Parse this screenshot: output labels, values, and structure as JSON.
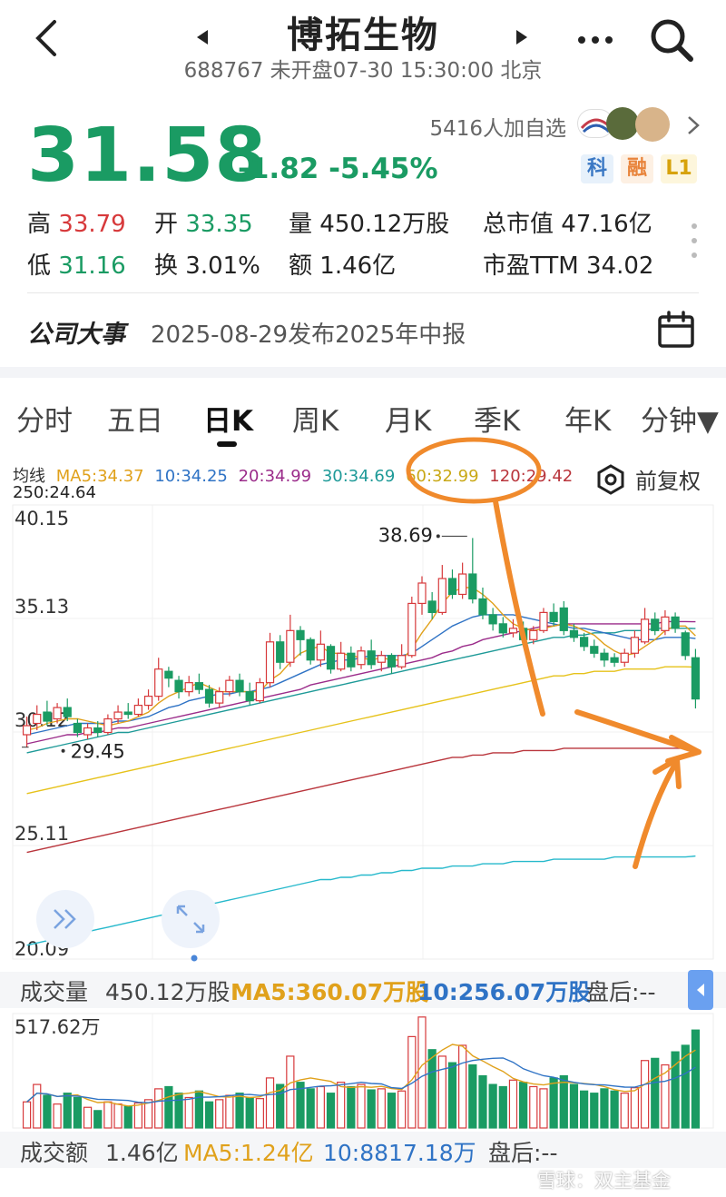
{
  "header": {
    "back_icon": "chevron-left-icon",
    "prev_icon": "triangle-left-icon",
    "next_icon": "triangle-right-icon",
    "title": "博拓生物",
    "subtitle": "688767 未开盘07-30 15:30:00 北京",
    "more_icon": "more-dots-icon",
    "search_icon": "search-icon"
  },
  "quote": {
    "price": "31.58",
    "change": "-1.82 -5.45%",
    "watchers": "5416人加自选",
    "tags": [
      "科",
      "融",
      "L1"
    ],
    "high_label": "高",
    "high": "33.79",
    "open_label": "开",
    "open": "33.35",
    "vol_label": "量",
    "vol": "450.12万股",
    "mcap_label": "总市值",
    "mcap": "47.16亿",
    "low_label": "低",
    "low": "31.16",
    "turn_label": "换",
    "turn": "3.01%",
    "amt_label": "额",
    "amt": "1.46亿",
    "pe_label": "市盈TTM",
    "pe": "34.02"
  },
  "event": {
    "title": "公司大事",
    "desc": "2025-08-29发布2025年中报",
    "calendar_icon": "calendar-icon"
  },
  "tabs": [
    "分时",
    "五日",
    "日K",
    "周K",
    "月K",
    "季K",
    "年K",
    "分钟▼"
  ],
  "active_tab": "日K",
  "ma_legend": {
    "label": "均线",
    "ma5": "MA5:34.37",
    "ma10": "10:34.25",
    "ma20": "20:34.99",
    "ma30": "30:34.69",
    "ma60": "60:32.99",
    "ma120": "120:29.42",
    "ma250": "250:24.64",
    "adjust": "前复权",
    "adjust_icon": "hexagon-settings-icon"
  },
  "colors": {
    "up": "#d7393b",
    "down": "#1a9b63",
    "ma5": "#e0a11b",
    "ma10": "#2f73c5",
    "ma20": "#9b2c8a",
    "ma30": "#1e9a98",
    "ma60": "#e6c21a",
    "ma120": "#b9353c",
    "ma250": "#27b9cc",
    "annotation": "#f08a2c"
  },
  "chart_data": {
    "type": "candlestick",
    "y_ticks": [
      "40.15",
      "35.13",
      "30.12",
      "25.11",
      "20.09"
    ],
    "ylim": [
      20.09,
      40.15
    ],
    "high_marker": "38.69",
    "low_marker": "29.45",
    "candles": [
      {
        "o": 30.0,
        "c": 30.4,
        "h": 30.8,
        "l": 29.45
      },
      {
        "o": 30.5,
        "c": 30.9,
        "h": 31.3,
        "l": 30.2
      },
      {
        "o": 31.0,
        "c": 30.6,
        "h": 31.5,
        "l": 30.4
      },
      {
        "o": 30.7,
        "c": 31.2,
        "h": 31.4,
        "l": 30.5
      },
      {
        "o": 31.2,
        "c": 30.8,
        "h": 31.6,
        "l": 30.6
      },
      {
        "o": 30.5,
        "c": 30.1,
        "h": 30.7,
        "l": 29.9
      },
      {
        "o": 30.0,
        "c": 30.3,
        "h": 30.5,
        "l": 29.8
      },
      {
        "o": 30.3,
        "c": 30.1,
        "h": 30.6,
        "l": 29.9
      },
      {
        "o": 30.1,
        "c": 30.7,
        "h": 30.9,
        "l": 30.0
      },
      {
        "o": 30.7,
        "c": 31.0,
        "h": 31.3,
        "l": 30.5
      },
      {
        "o": 31.0,
        "c": 30.9,
        "h": 31.4,
        "l": 30.7
      },
      {
        "o": 30.9,
        "c": 31.3,
        "h": 31.6,
        "l": 30.8
      },
      {
        "o": 31.3,
        "c": 31.7,
        "h": 32.0,
        "l": 31.1
      },
      {
        "o": 31.7,
        "c": 32.9,
        "h": 33.4,
        "l": 31.5
      },
      {
        "o": 32.8,
        "c": 32.5,
        "h": 33.0,
        "l": 32.1
      },
      {
        "o": 32.4,
        "c": 31.9,
        "h": 32.6,
        "l": 31.6
      },
      {
        "o": 31.9,
        "c": 32.3,
        "h": 32.6,
        "l": 31.7
      },
      {
        "o": 32.3,
        "c": 32.0,
        "h": 32.7,
        "l": 31.8
      },
      {
        "o": 32.0,
        "c": 31.4,
        "h": 32.2,
        "l": 31.2
      },
      {
        "o": 31.4,
        "c": 31.9,
        "h": 32.1,
        "l": 31.2
      },
      {
        "o": 31.9,
        "c": 32.4,
        "h": 32.6,
        "l": 31.7
      },
      {
        "o": 32.4,
        "c": 31.9,
        "h": 32.7,
        "l": 31.7
      },
      {
        "o": 31.9,
        "c": 31.5,
        "h": 32.3,
        "l": 31.3
      },
      {
        "o": 31.5,
        "c": 32.3,
        "h": 32.5,
        "l": 31.4
      },
      {
        "o": 32.3,
        "c": 34.1,
        "h": 34.5,
        "l": 32.1
      },
      {
        "o": 34.1,
        "c": 33.2,
        "h": 34.4,
        "l": 32.9
      },
      {
        "o": 33.2,
        "c": 34.6,
        "h": 35.3,
        "l": 33.0
      },
      {
        "o": 34.6,
        "c": 34.2,
        "h": 34.8,
        "l": 33.5
      },
      {
        "o": 34.2,
        "c": 33.3,
        "h": 34.3,
        "l": 33.1
      },
      {
        "o": 33.3,
        "c": 34.0,
        "h": 34.6,
        "l": 33.0
      },
      {
        "o": 33.9,
        "c": 32.9,
        "h": 34.0,
        "l": 32.7
      },
      {
        "o": 32.9,
        "c": 33.6,
        "h": 34.1,
        "l": 32.8
      },
      {
        "o": 33.6,
        "c": 33.0,
        "h": 33.9,
        "l": 32.8
      },
      {
        "o": 33.1,
        "c": 33.7,
        "h": 33.9,
        "l": 32.9
      },
      {
        "o": 33.7,
        "c": 33.1,
        "h": 34.2,
        "l": 32.9
      },
      {
        "o": 33.2,
        "c": 33.5,
        "h": 33.7,
        "l": 32.8
      },
      {
        "o": 33.5,
        "c": 33.0,
        "h": 33.6,
        "l": 32.7
      },
      {
        "o": 33.0,
        "c": 33.5,
        "h": 34.0,
        "l": 32.9
      },
      {
        "o": 33.5,
        "c": 35.8,
        "h": 36.1,
        "l": 33.4
      },
      {
        "o": 35.8,
        "c": 36.7,
        "h": 37.0,
        "l": 35.3
      },
      {
        "o": 35.9,
        "c": 35.4,
        "h": 36.3,
        "l": 35.1
      },
      {
        "o": 35.4,
        "c": 36.9,
        "h": 37.5,
        "l": 35.3
      },
      {
        "o": 36.9,
        "c": 36.2,
        "h": 37.3,
        "l": 36.0
      },
      {
        "o": 36.2,
        "c": 37.1,
        "h": 37.6,
        "l": 36.0
      },
      {
        "o": 37.1,
        "c": 36.0,
        "h": 38.69,
        "l": 35.8
      },
      {
        "o": 36.0,
        "c": 35.3,
        "h": 36.5,
        "l": 35.1
      },
      {
        "o": 35.3,
        "c": 34.9,
        "h": 35.6,
        "l": 34.6
      },
      {
        "o": 34.9,
        "c": 34.5,
        "h": 35.2,
        "l": 34.3
      },
      {
        "o": 34.5,
        "c": 34.7,
        "h": 35.1,
        "l": 34.3
      },
      {
        "o": 34.7,
        "c": 34.2,
        "h": 35.0,
        "l": 34.0
      },
      {
        "o": 34.2,
        "c": 34.6,
        "h": 34.8,
        "l": 34.0
      },
      {
        "o": 34.6,
        "c": 35.4,
        "h": 35.6,
        "l": 34.5
      },
      {
        "o": 35.4,
        "c": 35.0,
        "h": 35.8,
        "l": 34.8
      },
      {
        "o": 35.6,
        "c": 34.6,
        "h": 35.9,
        "l": 34.4
      },
      {
        "o": 34.6,
        "c": 34.3,
        "h": 34.9,
        "l": 34.1
      },
      {
        "o": 34.3,
        "c": 33.9,
        "h": 34.5,
        "l": 33.7
      },
      {
        "o": 33.9,
        "c": 33.6,
        "h": 34.2,
        "l": 33.4
      },
      {
        "o": 33.6,
        "c": 33.3,
        "h": 33.8,
        "l": 33.0
      },
      {
        "o": 33.4,
        "c": 33.2,
        "h": 33.6,
        "l": 33.0
      },
      {
        "o": 33.2,
        "c": 33.6,
        "h": 33.8,
        "l": 33.0
      },
      {
        "o": 33.6,
        "c": 34.3,
        "h": 34.6,
        "l": 33.4
      },
      {
        "o": 34.1,
        "c": 35.1,
        "h": 35.6,
        "l": 34.0
      },
      {
        "o": 35.1,
        "c": 34.6,
        "h": 35.4,
        "l": 34.4
      },
      {
        "o": 34.6,
        "c": 35.2,
        "h": 35.5,
        "l": 34.4
      },
      {
        "o": 35.2,
        "c": 34.7,
        "h": 35.4,
        "l": 34.5
      },
      {
        "o": 34.5,
        "c": 33.5,
        "h": 34.6,
        "l": 33.3
      },
      {
        "o": 33.4,
        "c": 31.58,
        "h": 33.79,
        "l": 31.16
      }
    ],
    "ma5": [
      30.2,
      30.3,
      30.5,
      30.6,
      30.7,
      30.7,
      30.6,
      30.5,
      30.4,
      30.5,
      30.6,
      30.8,
      31.0,
      31.4,
      31.7,
      31.9,
      32.1,
      32.3,
      32.1,
      31.9,
      31.9,
      31.9,
      31.9,
      31.9,
      32.4,
      32.7,
      33.2,
      33.6,
      33.8,
      33.9,
      33.6,
      33.6,
      33.5,
      33.4,
      33.3,
      33.4,
      33.3,
      33.3,
      33.8,
      34.5,
      35.1,
      35.8,
      36.3,
      36.5,
      36.5,
      36.2,
      35.8,
      35.3,
      34.9,
      34.7,
      34.6,
      34.7,
      34.8,
      34.9,
      34.8,
      34.6,
      34.4,
      34.0,
      33.7,
      33.5,
      33.6,
      33.9,
      34.2,
      34.6,
      34.8,
      34.8,
      34.37
    ],
    "ma10": [
      30.0,
      30.1,
      30.2,
      30.3,
      30.4,
      30.5,
      30.5,
      30.5,
      30.5,
      30.6,
      30.6,
      30.7,
      30.8,
      31.0,
      31.2,
      31.3,
      31.5,
      31.6,
      31.7,
      31.8,
      31.8,
      31.9,
      31.9,
      32.0,
      32.1,
      32.3,
      32.5,
      32.7,
      32.9,
      33.1,
      33.2,
      33.3,
      33.3,
      33.4,
      33.5,
      33.5,
      33.5,
      33.5,
      33.6,
      33.9,
      34.2,
      34.5,
      34.8,
      35.0,
      35.2,
      35.3,
      35.3,
      35.3,
      35.3,
      35.2,
      35.1,
      35.0,
      34.9,
      34.8,
      34.7,
      34.7,
      34.6,
      34.5,
      34.4,
      34.3,
      34.2,
      34.2,
      34.2,
      34.3,
      34.3,
      34.3,
      34.25
    ],
    "ma20": [
      29.6,
      29.7,
      29.8,
      29.9,
      30.0,
      30.0,
      30.1,
      30.1,
      30.2,
      30.3,
      30.3,
      30.4,
      30.5,
      30.6,
      30.7,
      30.8,
      30.9,
      31.0,
      31.1,
      31.2,
      31.3,
      31.4,
      31.5,
      31.6,
      31.7,
      31.8,
      31.9,
      32.0,
      32.2,
      32.3,
      32.4,
      32.5,
      32.6,
      32.7,
      32.8,
      32.9,
      33.0,
      33.1,
      33.2,
      33.3,
      33.4,
      33.6,
      33.7,
      33.9,
      34.0,
      34.2,
      34.3,
      34.4,
      34.5,
      34.6,
      34.7,
      34.8,
      34.8,
      34.9,
      34.9,
      34.9,
      34.9,
      34.9,
      34.9,
      34.9,
      34.9,
      34.9,
      34.9,
      35.0,
      35.0,
      35.0,
      34.99
    ],
    "ma30": [
      29.2,
      29.3,
      29.4,
      29.5,
      29.6,
      29.7,
      29.8,
      29.9,
      30.0,
      30.1,
      30.1,
      30.2,
      30.3,
      30.4,
      30.5,
      30.6,
      30.7,
      30.8,
      30.9,
      31.0,
      31.1,
      31.2,
      31.3,
      31.4,
      31.5,
      31.6,
      31.7,
      31.8,
      31.9,
      32.0,
      32.1,
      32.2,
      32.3,
      32.4,
      32.5,
      32.6,
      32.7,
      32.8,
      32.9,
      33.0,
      33.1,
      33.2,
      33.3,
      33.4,
      33.5,
      33.6,
      33.7,
      33.8,
      33.9,
      34.0,
      34.1,
      34.2,
      34.3,
      34.3,
      34.4,
      34.4,
      34.5,
      34.5,
      34.5,
      34.6,
      34.6,
      34.6,
      34.7,
      34.7,
      34.7,
      34.7,
      34.69
    ],
    "ma60": [
      27.4,
      27.5,
      27.6,
      27.7,
      27.8,
      27.9,
      28.0,
      28.1,
      28.2,
      28.3,
      28.4,
      28.5,
      28.6,
      28.7,
      28.8,
      28.9,
      29.0,
      29.1,
      29.2,
      29.3,
      29.4,
      29.5,
      29.6,
      29.7,
      29.8,
      29.9,
      30.0,
      30.1,
      30.2,
      30.3,
      30.4,
      30.5,
      30.6,
      30.7,
      30.8,
      30.9,
      31.0,
      31.1,
      31.2,
      31.3,
      31.4,
      31.5,
      31.6,
      31.7,
      31.8,
      31.9,
      32.0,
      32.1,
      32.2,
      32.3,
      32.4,
      32.5,
      32.6,
      32.6,
      32.7,
      32.7,
      32.8,
      32.8,
      32.8,
      32.9,
      32.9,
      32.9,
      32.9,
      33.0,
      33.0,
      33.0,
      32.99
    ],
    "ma120": [
      24.8,
      24.9,
      25.0,
      25.1,
      25.2,
      25.3,
      25.4,
      25.5,
      25.6,
      25.7,
      25.8,
      25.9,
      26.0,
      26.1,
      26.2,
      26.3,
      26.4,
      26.5,
      26.6,
      26.7,
      26.8,
      26.9,
      27.0,
      27.1,
      27.2,
      27.3,
      27.4,
      27.5,
      27.6,
      27.7,
      27.8,
      27.9,
      28.0,
      28.1,
      28.2,
      28.3,
      28.4,
      28.5,
      28.6,
      28.7,
      28.8,
      28.9,
      29.0,
      29.0,
      29.1,
      29.1,
      29.2,
      29.2,
      29.2,
      29.3,
      29.3,
      29.3,
      29.3,
      29.4,
      29.4,
      29.4,
      29.4,
      29.4,
      29.4,
      29.4,
      29.4,
      29.4,
      29.4,
      29.4,
      29.4,
      29.4,
      29.42
    ],
    "ma250": [
      20.7,
      20.8,
      20.9,
      21.0,
      21.1,
      21.2,
      21.3,
      21.4,
      21.5,
      21.6,
      21.7,
      21.8,
      21.9,
      22.0,
      22.1,
      22.2,
      22.3,
      22.4,
      22.5,
      22.6,
      22.7,
      22.8,
      22.9,
      23.0,
      23.1,
      23.2,
      23.3,
      23.4,
      23.5,
      23.6,
      23.6,
      23.7,
      23.7,
      23.8,
      23.8,
      23.9,
      23.9,
      24.0,
      24.0,
      24.1,
      24.1,
      24.1,
      24.2,
      24.2,
      24.2,
      24.3,
      24.3,
      24.3,
      24.4,
      24.4,
      24.4,
      24.4,
      24.5,
      24.5,
      24.5,
      24.5,
      24.5,
      24.5,
      24.6,
      24.6,
      24.6,
      24.6,
      24.6,
      24.6,
      24.6,
      24.6,
      24.64
    ]
  },
  "volume": {
    "label": "成交量",
    "value": "450.12万股",
    "ma5": "MA5:360.07万股",
    "ma10": "10:256.07万股",
    "after": "盘后:--",
    "max_label": "517.62万",
    "bars": [
      120,
      200,
      150,
      110,
      160,
      140,
      95,
      80,
      120,
      110,
      100,
      115,
      130,
      180,
      190,
      160,
      140,
      170,
      120,
      130,
      150,
      160,
      140,
      135,
      230,
      200,
      330,
      210,
      180,
      190,
      160,
      210,
      190,
      200,
      175,
      180,
      160,
      170,
      420,
      510,
      360,
      330,
      300,
      380,
      290,
      240,
      200,
      190,
      220,
      210,
      190,
      180,
      230,
      240,
      200,
      170,
      160,
      180,
      170,
      160,
      185,
      310,
      320,
      290,
      350,
      380,
      450.12
    ]
  },
  "amount": {
    "label": "成交额",
    "value": "1.46亿",
    "ma5": "MA5:1.24亿",
    "ma10": "10:8817.18万",
    "after": "盘后:--"
  },
  "float_buttons": {
    "expand_icon": "double-chevron-right-icon",
    "fullscreen_icon": "arrows-expand-icon",
    "collapse_icon": "triangle-left-icon"
  },
  "watermark": "雪球：双主基金"
}
